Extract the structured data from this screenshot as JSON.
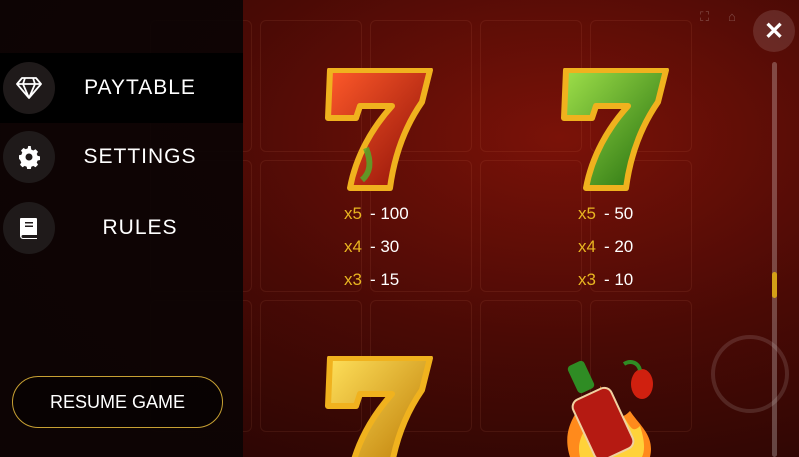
{
  "menu": {
    "items": [
      {
        "label": "PAYTABLE",
        "icon": "diamond-icon",
        "active": true
      },
      {
        "label": "SETTINGS",
        "icon": "gear-icon",
        "active": false
      },
      {
        "label": "RULES",
        "icon": "book-icon",
        "active": false
      }
    ],
    "resume_label": "RESUME GAME"
  },
  "paytable": {
    "symbols": [
      {
        "name": "red-seven",
        "color": "#c8261a",
        "payouts": [
          {
            "mult": "x5",
            "value": "- 100"
          },
          {
            "mult": "x4",
            "value": "- 30"
          },
          {
            "mult": "x3",
            "value": "- 15"
          }
        ]
      },
      {
        "name": "green-seven",
        "color": "#3c9a1f",
        "payouts": [
          {
            "mult": "x5",
            "value": "- 50"
          },
          {
            "mult": "x4",
            "value": "- 20"
          },
          {
            "mult": "x3",
            "value": "- 10"
          }
        ]
      },
      {
        "name": "yellow-seven",
        "color": "#e2a20a",
        "payouts": []
      },
      {
        "name": "hot-sauce-bottle",
        "color": "#d8321c",
        "payouts": []
      }
    ]
  },
  "colors": {
    "accent_gold": "#e8b521",
    "menu_bg": "#0a0404",
    "background": "#4a0a05"
  }
}
